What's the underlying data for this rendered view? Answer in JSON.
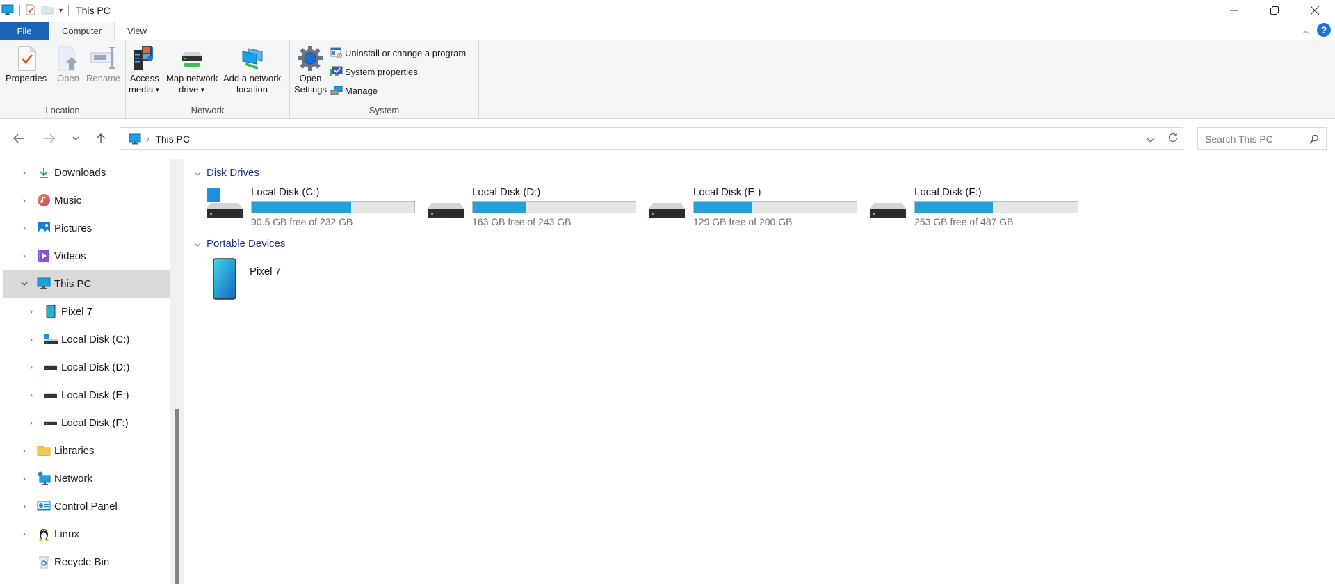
{
  "window": {
    "title": "This PC",
    "controls": {
      "minimize": "—",
      "maximize": "❐",
      "close": "✕"
    }
  },
  "ribbon": {
    "tabs": [
      {
        "label": "File"
      },
      {
        "label": "Computer"
      },
      {
        "label": "View"
      }
    ],
    "groups": {
      "location": {
        "label": "Location",
        "buttons": [
          {
            "label": "Properties",
            "icon": "properties-icon",
            "enabled": true
          },
          {
            "label": "Open",
            "icon": "open-icon",
            "enabled": false
          },
          {
            "label": "Rename",
            "icon": "rename-icon",
            "enabled": false
          }
        ]
      },
      "network": {
        "label": "Network",
        "buttons": [
          {
            "line1": "Access",
            "line2": "media",
            "icon": "access-media-icon",
            "dropdown": true
          },
          {
            "line1": "Map network",
            "line2": "drive",
            "icon": "map-network-drive-icon",
            "dropdown": true
          },
          {
            "line1": "Add a network",
            "line2": "location",
            "icon": "add-network-location-icon",
            "dropdown": false
          }
        ]
      },
      "system": {
        "label": "System",
        "open_settings": {
          "line1": "Open",
          "line2": "Settings"
        },
        "small_buttons": [
          {
            "label": "Uninstall or change a program",
            "icon": "uninstall-program-icon"
          },
          {
            "label": "System properties",
            "icon": "system-properties-icon"
          },
          {
            "label": "Manage",
            "icon": "manage-icon"
          }
        ]
      }
    }
  },
  "address_bar": {
    "breadcrumb": [
      "This PC"
    ],
    "search_placeholder": "Search This PC"
  },
  "sidebar": {
    "items": [
      {
        "label": "Downloads",
        "icon": "downloads-icon",
        "expanded": false
      },
      {
        "label": "Music",
        "icon": "music-icon",
        "expanded": false
      },
      {
        "label": "Pictures",
        "icon": "pictures-icon",
        "expanded": false
      },
      {
        "label": "Videos",
        "icon": "videos-icon",
        "expanded": false
      },
      {
        "label": "This PC",
        "icon": "this-pc-icon",
        "expanded": true,
        "selected": true
      },
      {
        "label": "Pixel 7",
        "icon": "phone-icon",
        "expanded": false
      },
      {
        "label": "Local Disk (C:)",
        "icon": "windows-drive-icon",
        "expanded": false
      },
      {
        "label": "Local Disk (D:)",
        "icon": "drive-icon",
        "expanded": false
      },
      {
        "label": "Local Disk (E:)",
        "icon": "drive-icon",
        "expanded": false
      },
      {
        "label": "Local Disk (F:)",
        "icon": "drive-icon",
        "expanded": false
      },
      {
        "label": "Libraries",
        "icon": "libraries-icon",
        "expanded": false
      },
      {
        "label": "Network",
        "icon": "network-icon",
        "expanded": false
      },
      {
        "label": "Control Panel",
        "icon": "control-panel-icon",
        "expanded": false
      },
      {
        "label": "Linux",
        "icon": "linux-icon",
        "expanded": false
      },
      {
        "label": "Recycle Bin",
        "icon": "recycle-bin-icon"
      }
    ]
  },
  "content": {
    "disk_drives": {
      "heading": "Disk Drives",
      "drives": [
        {
          "name": "Local Disk (C:)",
          "free": "90.5 GB free of 232 GB",
          "used_fraction": 0.61,
          "system": true
        },
        {
          "name": "Local Disk (D:)",
          "free": "163 GB free of 243 GB",
          "used_fraction": 0.33
        },
        {
          "name": "Local Disk (E:)",
          "free": "129 GB free of 200 GB",
          "used_fraction": 0.355
        },
        {
          "name": "Local Disk (F:)",
          "free": "253 GB free of 487 GB",
          "used_fraction": 0.48
        }
      ]
    },
    "portable_devices": {
      "heading": "Portable Devices",
      "devices": [
        {
          "name": "Pixel 7"
        }
      ]
    }
  },
  "colors": {
    "accent": "#1b63b7",
    "bar_fill": "#26a0da",
    "group_heading": "#1e3287"
  }
}
